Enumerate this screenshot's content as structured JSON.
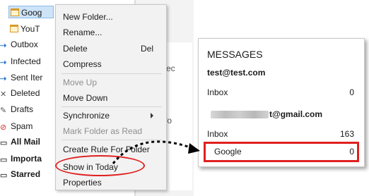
{
  "folders": [
    {
      "label": "Goog",
      "icon": "folder-icon",
      "selected": true
    },
    {
      "label": "YouT",
      "icon": "folder-icon",
      "selected": false
    },
    {
      "label": "Outbox",
      "icon": "outbox-icon"
    },
    {
      "label": "Infected",
      "icon": "infected-icon"
    },
    {
      "label": "Sent Iter",
      "icon": "sent-icon"
    },
    {
      "label": "Deleted",
      "icon": "trash-icon"
    },
    {
      "label": "Drafts",
      "icon": "drafts-icon"
    },
    {
      "label": "Spam",
      "icon": "spam-icon"
    },
    {
      "label": "All Mail",
      "icon": "inbox-icon",
      "bold": true
    },
    {
      "label": "Importa",
      "icon": "important-icon",
      "bold": true
    },
    {
      "label": "Starred",
      "icon": "star-icon",
      "bold": true
    }
  ],
  "background_fragments": {
    "frag1": "ec",
    "frag2": "fo"
  },
  "context_menu": {
    "items": [
      {
        "label": "New Folder...",
        "enabled": true
      },
      {
        "label": "Rename...",
        "enabled": true
      },
      {
        "label": "Delete",
        "shortcut": "Del",
        "enabled": true
      },
      {
        "label": "Compress",
        "enabled": true
      },
      {
        "label": "Move Up",
        "enabled": false
      },
      {
        "label": "Move Down",
        "enabled": true
      },
      {
        "label": "Synchronize",
        "enabled": true,
        "submenu": true
      },
      {
        "label": "Mark Folder as Read",
        "enabled": false
      },
      {
        "label": "Create Rule For Folder",
        "enabled": true
      },
      {
        "label": "Show in Today",
        "enabled": true,
        "highlighted": true
      },
      {
        "label": "Properties",
        "enabled": true
      }
    ]
  },
  "messages": {
    "title": "MESSAGES",
    "account1": "test@test.com",
    "account1_inbox_label": "Inbox",
    "account1_inbox_count": "0",
    "account2_visible": "t@gmail.com",
    "account2_inbox_label": "Inbox",
    "account2_inbox_count": "163",
    "account2_google_label": "Google",
    "account2_google_count": "0"
  },
  "colors": {
    "annotation_red": "#e02020",
    "selection_blue": "#cde3f7",
    "menu_bg": "#f2f2f2"
  }
}
